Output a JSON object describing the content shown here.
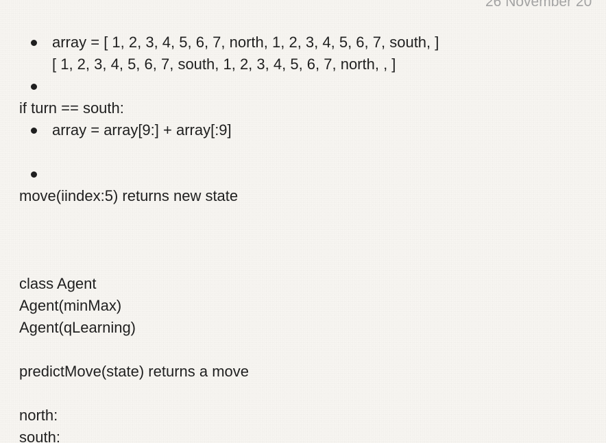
{
  "header": {
    "date": "26 November 20"
  },
  "note": {
    "l1": "array = [ 1, 2, 3, 4, 5, 6, 7, north, 1, 2, 3, 4, 5, 6, 7, south, ]",
    "l2": "[ 1, 2, 3, 4, 5, 6, 7, south, 1, 2, 3, 4, 5, 6, 7, north, , ]",
    "l3": "if turn == south:",
    "l4": "array = array[9:] + array[:9]",
    "l5": "move(iindex:5) returns new state",
    "l6": "class Agent",
    "l7": "Agent(minMax)",
    "l8": "Agent(qLearning)",
    "l9": "predictMove(state) returns a move",
    "l10": "north:",
    "l11": "south:"
  }
}
